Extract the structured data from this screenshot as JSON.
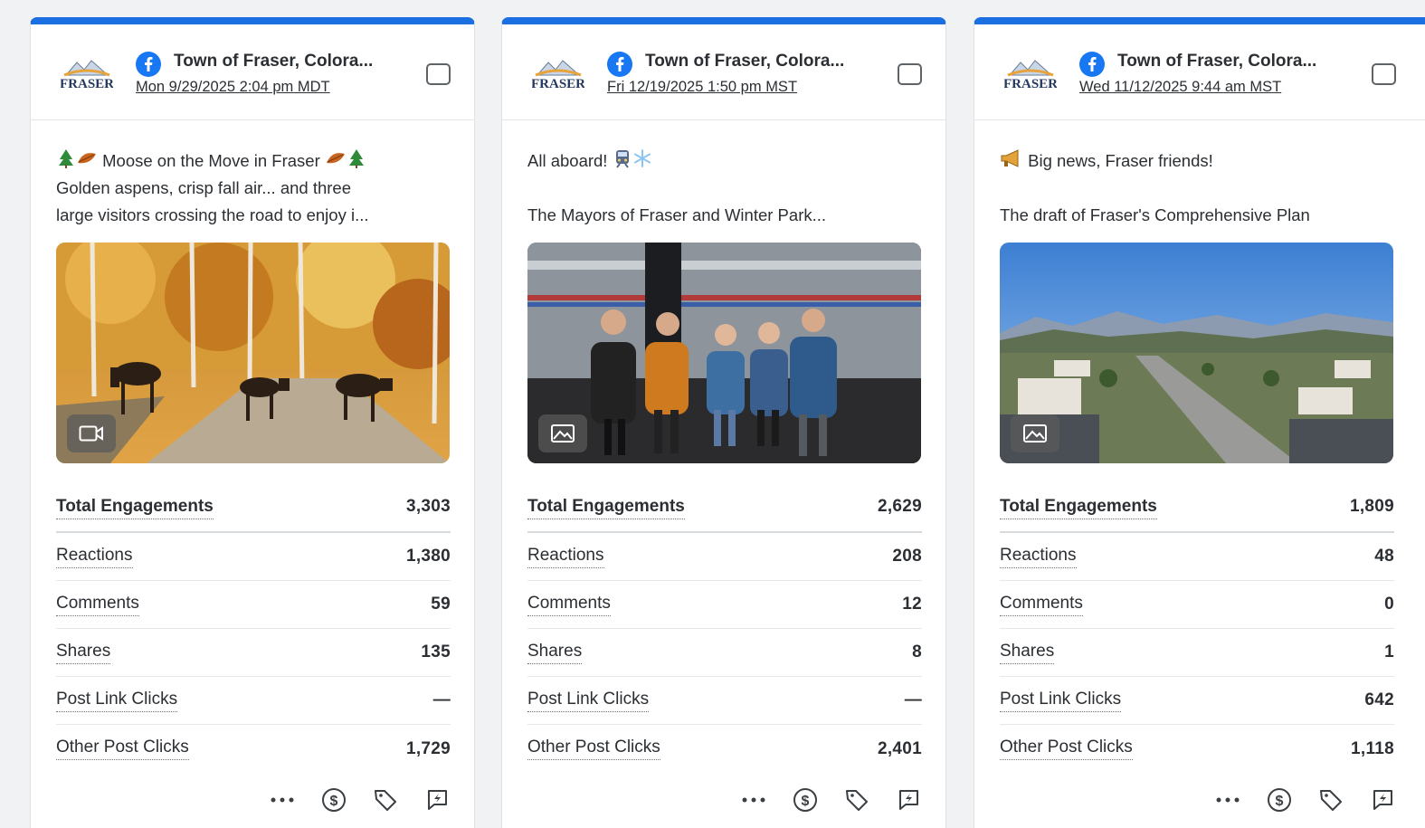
{
  "cards": [
    {
      "page_name": "Town of Fraser, Colora...",
      "date": "Mon 9/29/2025 2:04 pm MDT",
      "text_line1": "Moose on the Move in Fraser",
      "text_line2": "Golden aspens, crisp fall air... and three",
      "text_line3": "large visitors crossing the road to enjoy i...",
      "media_type": "video-icon",
      "metrics": [
        {
          "label": "Total Engagements",
          "value": "3,303"
        },
        {
          "label": "Reactions",
          "value": "1,380"
        },
        {
          "label": "Comments",
          "value": "59"
        },
        {
          "label": "Shares",
          "value": "135"
        },
        {
          "label": "Post Link Clicks",
          "value": "—"
        },
        {
          "label": "Other Post Clicks",
          "value": "1,729"
        }
      ]
    },
    {
      "page_name": "Town of Fraser, Colora...",
      "date": "Fri 12/19/2025 1:50 pm MST",
      "text_line1": "All aboard!",
      "text_line2": "",
      "text_line3": "The Mayors of Fraser and Winter Park...",
      "media_type": "image-icon",
      "metrics": [
        {
          "label": "Total Engagements",
          "value": "2,629"
        },
        {
          "label": "Reactions",
          "value": "208"
        },
        {
          "label": "Comments",
          "value": "12"
        },
        {
          "label": "Shares",
          "value": "8"
        },
        {
          "label": "Post Link Clicks",
          "value": "—"
        },
        {
          "label": "Other Post Clicks",
          "value": "2,401"
        }
      ]
    },
    {
      "page_name": "Town of Fraser, Colora...",
      "date": "Wed 11/12/2025 9:44 am MST",
      "text_line1": "Big news, Fraser friends!",
      "text_line2": "",
      "text_line3": "The draft of Fraser's Comprehensive Plan",
      "media_type": "image-icon",
      "metrics": [
        {
          "label": "Total Engagements",
          "value": "1,809"
        },
        {
          "label": "Reactions",
          "value": "48"
        },
        {
          "label": "Comments",
          "value": "0"
        },
        {
          "label": "Shares",
          "value": "1"
        },
        {
          "label": "Post Link Clicks",
          "value": "642"
        },
        {
          "label": "Other Post Clicks",
          "value": "1,118"
        }
      ]
    }
  ],
  "colors": {
    "accent": "#1b6fe0",
    "facebook": "#1877f2"
  },
  "logo_text": "FRASER"
}
